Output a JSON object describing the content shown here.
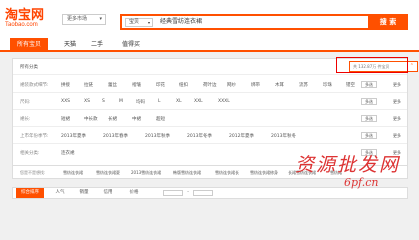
{
  "logo": {
    "cn": "淘宝网",
    "en": "Taobao.com"
  },
  "search": {
    "market_label": "更多市场",
    "type_label": "宝贝",
    "query": "经典雪纺连衣裙",
    "button_label": "搜 索"
  },
  "tabs": [
    {
      "label": "所有宝贝",
      "active": true
    },
    {
      "label": "天猫",
      "active": false
    },
    {
      "label": "二手",
      "active": false
    },
    {
      "label": "值得买",
      "active": false
    }
  ],
  "filters": {
    "breadcrumb": "所有分类",
    "result_count": "共 132.87万 件宝贝",
    "rows": [
      {
        "label": "裙装款式细节:",
        "items": [
          "拼接",
          "拉链",
          "蕾丝",
          "褶皱",
          "印花",
          "纽扣",
          "荷叶边",
          "网纱",
          "绑带",
          "木耳",
          "流苏",
          "珍珠",
          "镂空"
        ],
        "multi": "多选",
        "more": "更多"
      },
      {
        "label": "尺码:",
        "items": [
          "XXS",
          "XS",
          "S",
          "M",
          "均码",
          "L",
          "XL",
          "XXL",
          "XXXL"
        ],
        "multi": "多选",
        "more": "更多"
      },
      {
        "label": "裙长:",
        "items": [
          "短裙",
          "中长款",
          "长裙",
          "中裙",
          "超短"
        ],
        "multi": "多选",
        "more": "更多"
      },
      {
        "label": "上市年份季节:",
        "items": [
          "2013年夏季",
          "2013年春季",
          "2013年秋季",
          "2013年冬季",
          "2012年夏季",
          "2013年秋冬"
        ],
        "multi": "多选",
        "more": "更多"
      },
      {
        "label": "相关分类:",
        "items": [
          "连衣裙"
        ],
        "multi": "多选",
        "more": "更多"
      }
    ]
  },
  "related": {
    "label": "您是不是想找:",
    "items": [
      "雪纺连衣裙",
      "雪纺连衣裙夏",
      "2013雪纺连衣裙",
      "韩版雪纺连衣裙",
      "雪纺连衣裙长",
      "雪纺连衣裙修身",
      "长裙雪纺连衣裙",
      "雪纺裙"
    ]
  },
  "sortbar": {
    "items": [
      {
        "label": "综合排序",
        "active": true
      },
      {
        "label": "人气",
        "active": false
      },
      {
        "label": "销量",
        "active": false
      },
      {
        "label": "信用",
        "active": false
      },
      {
        "label": "价格",
        "active": false
      }
    ],
    "price_sep": "-"
  },
  "watermark": {
    "cn": "资源批发网",
    "en": "6pf.cn"
  },
  "colors": {
    "accent": "#ff5000",
    "logo": "#ff4400",
    "watermark": "#dd3333"
  }
}
